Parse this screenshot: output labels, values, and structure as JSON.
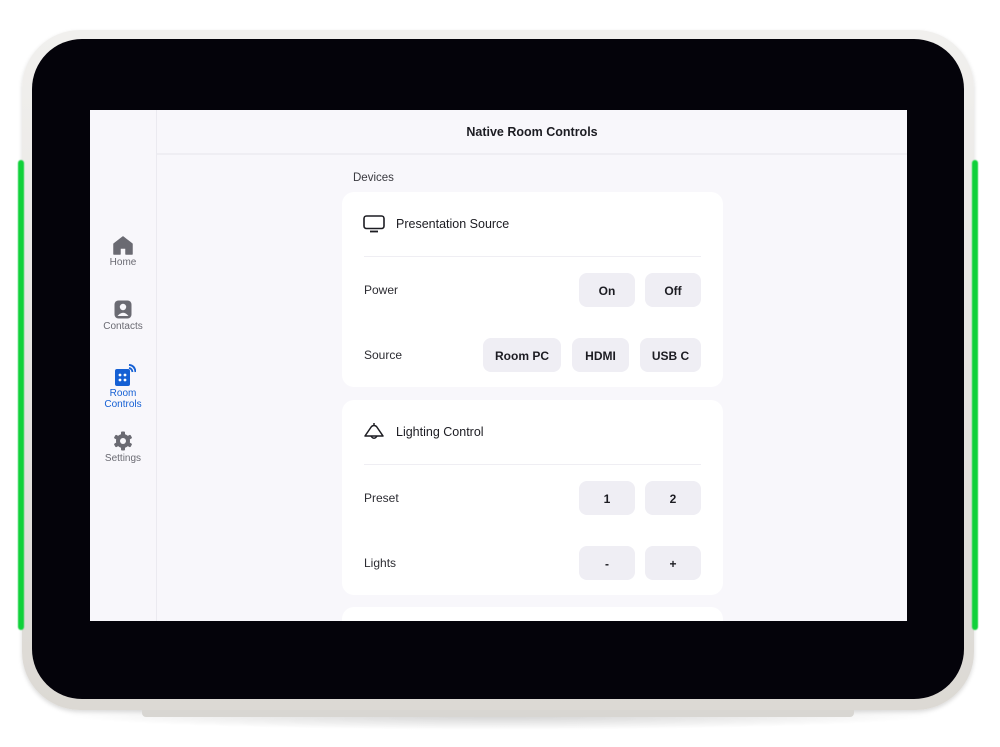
{
  "header": {
    "title": "Native Room Controls"
  },
  "sidebar": {
    "items": [
      {
        "label": "Home",
        "icon": "home-icon",
        "active": false
      },
      {
        "label": "Contacts",
        "icon": "contact-icon",
        "active": false
      },
      {
        "label": "Room Controls",
        "icon": "room-controls-icon",
        "active": true
      },
      {
        "label": "Settings",
        "icon": "gear-icon",
        "active": false
      }
    ]
  },
  "main": {
    "section_label": "Devices",
    "cards": [
      {
        "title": "Presentation Source",
        "icon": "monitor-icon",
        "rows": [
          {
            "label": "Power",
            "buttons": [
              "On",
              "Off"
            ]
          },
          {
            "label": "Source",
            "buttons": [
              "Room PC",
              "HDMI",
              "USB C"
            ]
          }
        ]
      },
      {
        "title": "Lighting Control",
        "icon": "ceiling-lamp-icon",
        "rows": [
          {
            "label": "Preset",
            "buttons": [
              "1",
              "2"
            ]
          },
          {
            "label": "Lights",
            "buttons": [
              "-",
              "+"
            ]
          }
        ]
      }
    ]
  },
  "colors": {
    "accent": "#1560d4",
    "led": "#10d13a",
    "bezel": "#04030a",
    "screen_bg": "#f8f7fb",
    "button_bg": "#efeef4"
  }
}
